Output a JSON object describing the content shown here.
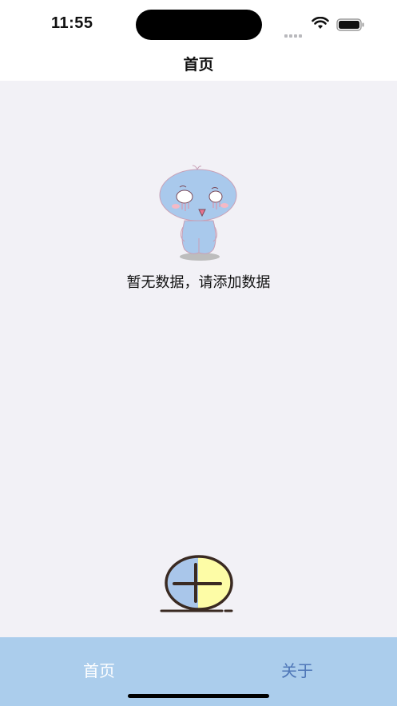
{
  "status_bar": {
    "time": "11:55",
    "signal_icon": "cellular-signal-icon",
    "wifi_icon": "wifi-icon",
    "battery_icon": "battery-icon"
  },
  "nav": {
    "title": "首页"
  },
  "empty_state": {
    "illustration_icon": "blue-mascot-illustration",
    "message": "暂无数据，请添加数据"
  },
  "add_button": {
    "icon": "plus-circle-icon"
  },
  "tab_bar": {
    "tabs": [
      {
        "label": "首页",
        "selected": true
      },
      {
        "label": "关于",
        "selected": false
      }
    ]
  },
  "colors": {
    "background": "#f2f1f6",
    "tab_bar": "#abcdec",
    "tab_selected": "#ffffff",
    "tab_unselected": "#4f77b8",
    "add_left": "#a9c6ea",
    "add_right": "#fdfca6"
  }
}
